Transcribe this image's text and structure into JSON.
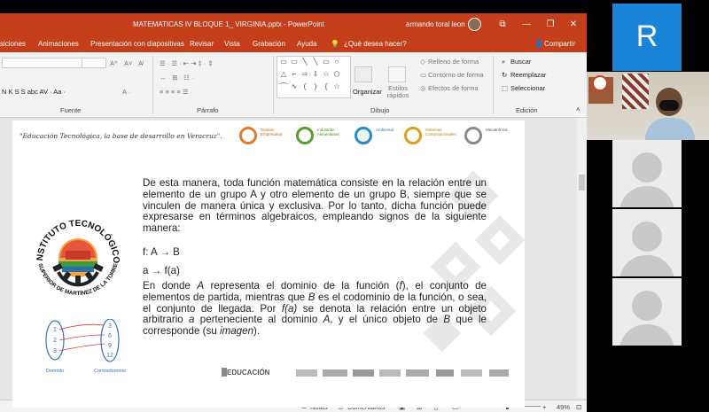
{
  "window": {
    "title": "MATEMATICAS IV BLOQUE 1_ VIRGINIA.pptx - PowerPoint",
    "user": "armando toral leon",
    "controls": [
      "⧉",
      "—",
      "❐",
      "✕"
    ]
  },
  "tabs": [
    "siciones",
    "Animaciones",
    "Presentación con diapositivas",
    "Revisar",
    "Vista",
    "Grabación",
    "Ayuda",
    "¿Qué desea hacer?",
    "Compartir"
  ],
  "ribbon": {
    "groups": [
      "Fuente",
      "Párrafo",
      "Dibujo",
      "Edición"
    ],
    "organizar": "Organizar",
    "estilos_rapidos": "Estilos rápidos",
    "relleno": "Relleno de forma",
    "contorno": "Contorno de forma",
    "efectos": "Efectos de forma",
    "buscar": "Buscar",
    "reemplazar": "Reemplazar",
    "seleccionar": "Seleccionar"
  },
  "slide": {
    "motto": "\"Educación Tecnológica, la base de desarrollo en Veracruz\".",
    "departments": [
      {
        "name": "Gestión Empresarial",
        "color": "#e07a2a"
      },
      {
        "name": "Industrias Alimentarias",
        "color": "#5a9c2e"
      },
      {
        "name": "Ambiental",
        "color": "#2a8ac0"
      },
      {
        "name": "Sistemas Computacionales",
        "color": "#d8a020"
      },
      {
        "name": "Mecatrónica",
        "color": "#8a8a8a"
      }
    ],
    "logo": {
      "top_text": "INSTITUTO TECNOLÓGICO",
      "bottom_text": "SUPERIOR DE MARTÍNEZ DE LA TORRE"
    },
    "paragraph1": "De esta manera, toda función matemática consiste en la relación entre un elemento de un grupo A y otro elemento de un grupo B, siempre que se vinculen de manera única y exclusiva. Por lo tanto, dicha función puede expresarse en términos algebraicos, empleando signos de la siguiente manera:",
    "math1": "f: A → B",
    "math2": "a → f(a)",
    "paragraph2_parts": [
      "En donde ",
      "A",
      " representa el dominio de la función (",
      "f",
      "), el conjunto de elementos de partida, mientras que ",
      "B",
      " es el codominio de la función, o sea, el conjunto de llegada. Por ",
      "f(a)",
      " se denota la relación entre un objeto arbitrario ",
      "a",
      " perteneciente al dominio ",
      "A",
      ", y el único objeto de ",
      "B",
      " que le corresponde (su ",
      "imagen",
      ")."
    ],
    "diagram": {
      "domain_values": [
        "1",
        "2",
        "3"
      ],
      "codomain_values": [
        "3",
        "6",
        "9",
        "12"
      ],
      "domain_label": "Dominio",
      "codomain_label": "Contradominio"
    },
    "footer_brand": "EDUCACIÓN"
  },
  "status": {
    "notas": "Notas",
    "comentarios": "Comentarios",
    "zoom": "49%"
  },
  "participants": {
    "active_initial": "R"
  }
}
